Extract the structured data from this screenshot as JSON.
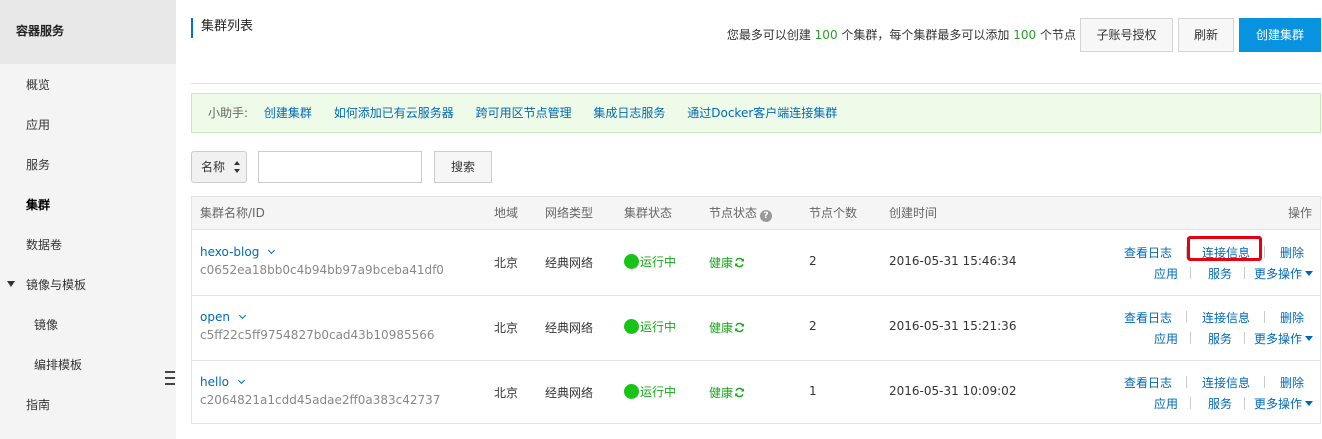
{
  "sidebar": {
    "title": "容器服务",
    "items": [
      {
        "label": "概览"
      },
      {
        "label": "应用"
      },
      {
        "label": "服务"
      },
      {
        "label": "集群"
      },
      {
        "label": "数据卷"
      },
      {
        "label": "镜像与模板"
      },
      {
        "label": "镜像"
      },
      {
        "label": "编排模板"
      },
      {
        "label": "指南"
      }
    ]
  },
  "header": {
    "title": "集群列表",
    "quota_prefix": "您最多可以创建",
    "quota_clusters": "100",
    "quota_middle": "个集群，每个集群最多可以添加",
    "quota_nodes": "100",
    "quota_suffix": "个节点",
    "btn_subaccount": "子账号授权",
    "btn_refresh": "刷新",
    "btn_create": "创建集群"
  },
  "helper": {
    "label": "小助手:",
    "links": [
      "创建集群",
      "如何添加已有云服务器",
      "跨可用区节点管理",
      "集成日志服务",
      "通过Docker客户端连接集群"
    ]
  },
  "search": {
    "select_value": "名称",
    "input_value": "",
    "button": "搜索"
  },
  "table": {
    "headers": {
      "name": "集群名称/ID",
      "region": "地域",
      "network": "网络类型",
      "status": "集群状态",
      "node_status": "节点状态",
      "node_count": "节点个数",
      "created": "创建时间",
      "ops": "操作"
    },
    "ops": {
      "logs": "查看日志",
      "connect": "连接信息",
      "delete": "删除",
      "apps": "应用",
      "services": "服务",
      "more": "更多操作"
    },
    "rows": [
      {
        "name": "hexo-blog",
        "id": "c0652ea18bb0c4b94bb97a9bceba41df0",
        "region": "北京",
        "network": "经典网络",
        "status": "运行中",
        "health": "健康",
        "nodes": "2",
        "created": "2016-05-31 15:46:34"
      },
      {
        "name": "open",
        "id": "c5ff22c5ff9754827b0cad43b10985566",
        "region": "北京",
        "network": "经典网络",
        "status": "运行中",
        "health": "健康",
        "nodes": "2",
        "created": "2016-05-31 15:21:36"
      },
      {
        "name": "hello",
        "id": "c2064821a1cdd45adae2ff0a383c42737",
        "region": "北京",
        "network": "经典网络",
        "status": "运行中",
        "health": "健康",
        "nodes": "1",
        "created": "2016-05-31 10:09:02"
      }
    ]
  },
  "colors": {
    "accent": "#0893e0",
    "link": "#0068b7",
    "success": "#19c319",
    "highlight": "#e60012"
  }
}
